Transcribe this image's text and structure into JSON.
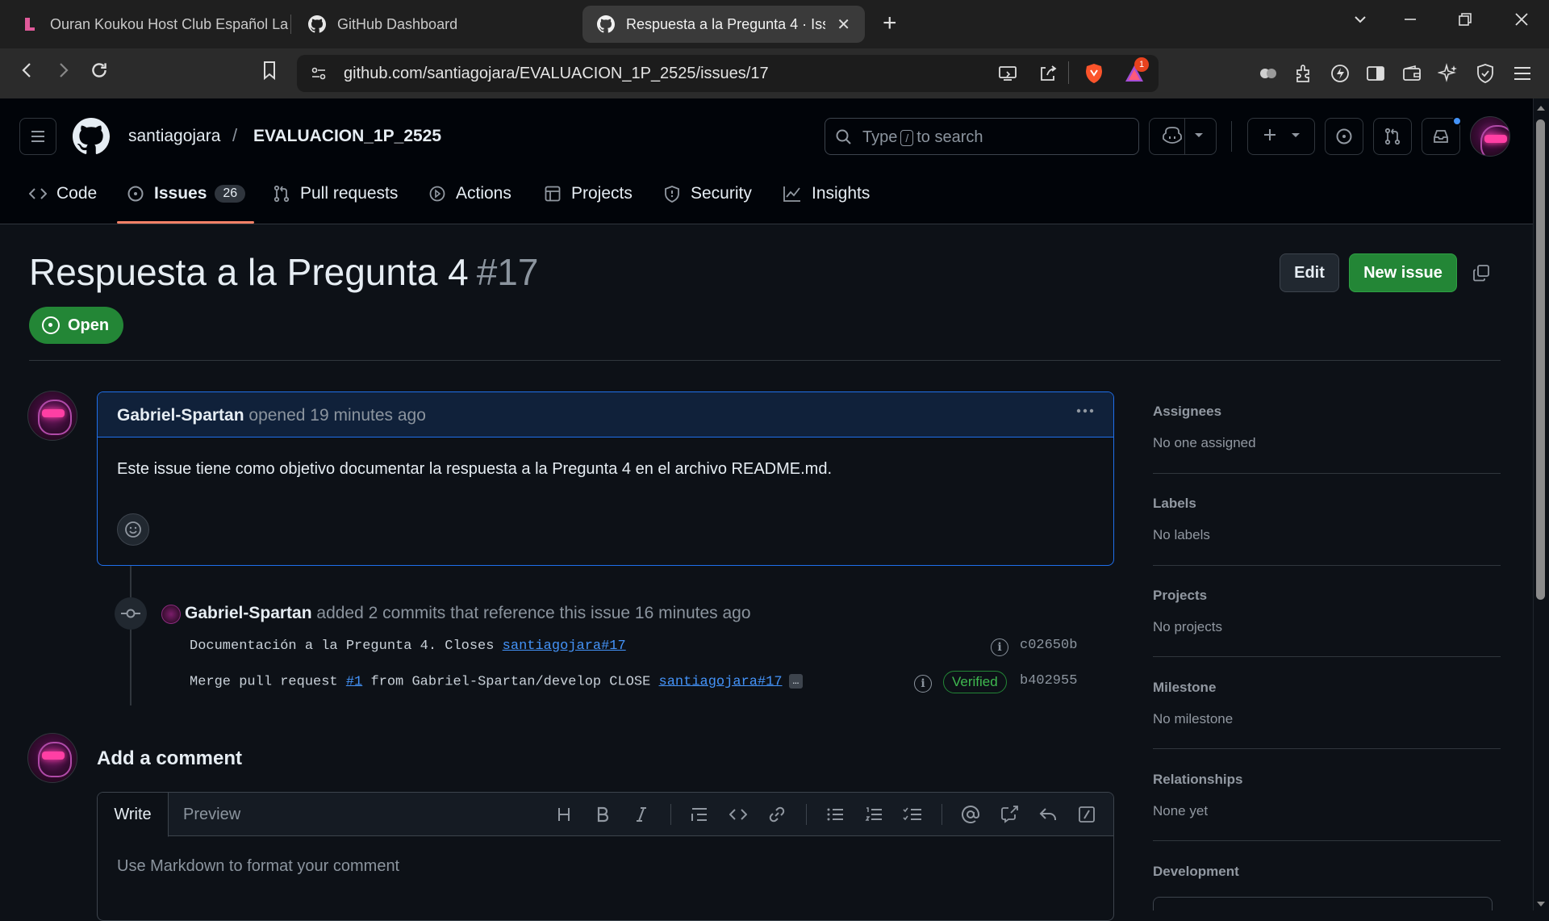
{
  "browser": {
    "tabs": [
      {
        "title": "Ouran Koukou Host Club Español La"
      },
      {
        "title": "GitHub Dashboard"
      },
      {
        "title": "Respuesta a la Pregunta 4 · Issu"
      }
    ],
    "url": "github.com/santiagojara/EVALUACION_1P_2525/issues/17",
    "notification_badge": "1"
  },
  "header": {
    "owner": "santiagojara",
    "separator": "/",
    "repo": "EVALUACION_1P_2525",
    "search_type": "Type",
    "search_key": "/",
    "search_rest": "to search"
  },
  "repo_nav": {
    "code": "Code",
    "issues": "Issues",
    "issues_count": "26",
    "pulls": "Pull requests",
    "actions": "Actions",
    "projects": "Projects",
    "security": "Security",
    "insights": "Insights"
  },
  "issue": {
    "title": "Respuesta a la Pregunta 4",
    "number": "#17",
    "state": "Open",
    "edit_label": "Edit",
    "new_label": "New issue"
  },
  "comment": {
    "author": "Gabriel-Spartan",
    "meta": "opened 19 minutes ago",
    "body": "Este issue tiene como objetivo documentar la respuesta a la Pregunta 4 en el archivo README.md."
  },
  "event": {
    "author": "Gabriel-Spartan",
    "text": "added 2 commits that reference this issue 16 minutes ago",
    "commits": [
      {
        "message": "Documentación a la Pregunta 4. Closes ",
        "link": "santiagojara#17",
        "sha": "c02650b"
      },
      {
        "message_a": "Merge pull request ",
        "pr_link": "#1",
        "message_b": " from Gabriel-Spartan/develop CLOSE ",
        "link": "santiagojara#17",
        "more": "…",
        "verified": "Verified",
        "sha": "b402955"
      }
    ]
  },
  "add_comment": {
    "title": "Add a comment",
    "write": "Write",
    "preview": "Preview",
    "placeholder": "Use Markdown to format your comment"
  },
  "sidebar": {
    "assignees_h": "Assignees",
    "assignees_v": "No one assigned",
    "labels_h": "Labels",
    "labels_v": "No labels",
    "projects_h": "Projects",
    "projects_v": "No projects",
    "milestone_h": "Milestone",
    "milestone_v": "No milestone",
    "relationships_h": "Relationships",
    "relationships_v": "None yet",
    "development_h": "Development"
  },
  "colors": {
    "open_green": "#238636",
    "link_blue": "#4493f8",
    "tab_underline": "#f78166"
  }
}
